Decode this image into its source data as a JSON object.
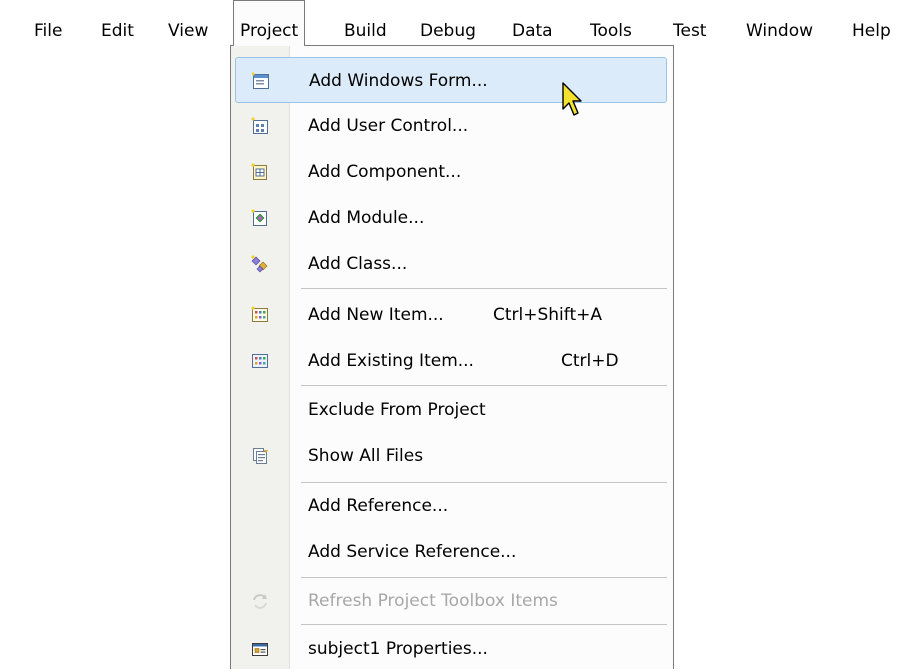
{
  "menubar": {
    "items": [
      {
        "label": "File"
      },
      {
        "label": "Edit"
      },
      {
        "label": "View"
      },
      {
        "label": "Project"
      },
      {
        "label": "Build"
      },
      {
        "label": "Debug"
      },
      {
        "label": "Data"
      },
      {
        "label": "Tools"
      },
      {
        "label": "Test"
      },
      {
        "label": "Window"
      },
      {
        "label": "Help"
      }
    ]
  },
  "project_menu": {
    "items": [
      {
        "label": "Add Windows Form...",
        "icon": "windows-form-icon",
        "highlighted": true
      },
      {
        "label": "Add User Control...",
        "icon": "user-control-icon"
      },
      {
        "label": "Add Component...",
        "icon": "component-icon"
      },
      {
        "label": "Add Module...",
        "icon": "module-icon"
      },
      {
        "label": "Add Class...",
        "icon": "class-icon"
      },
      {
        "label": "Add New Item...",
        "shortcut": "Ctrl+Shift+A",
        "icon": "new-item-icon"
      },
      {
        "label": "Add Existing Item...",
        "shortcut": "Ctrl+D",
        "icon": "existing-item-icon"
      },
      {
        "label": "Exclude From Project"
      },
      {
        "label": "Show All Files",
        "icon": "show-all-files-icon"
      },
      {
        "label": "Add Reference..."
      },
      {
        "label": "Add Service Reference..."
      },
      {
        "label": "Refresh Project Toolbox Items",
        "icon": "refresh-toolbox-icon",
        "disabled": true
      },
      {
        "label": "subject1 Properties...",
        "icon": "properties-icon"
      }
    ]
  },
  "colors": {
    "highlight_fill": "#dcebf9",
    "highlight_border": "#9dc3e8",
    "disabled_text": "#a7a7a7",
    "icon_strip": "#f1f1ee"
  }
}
